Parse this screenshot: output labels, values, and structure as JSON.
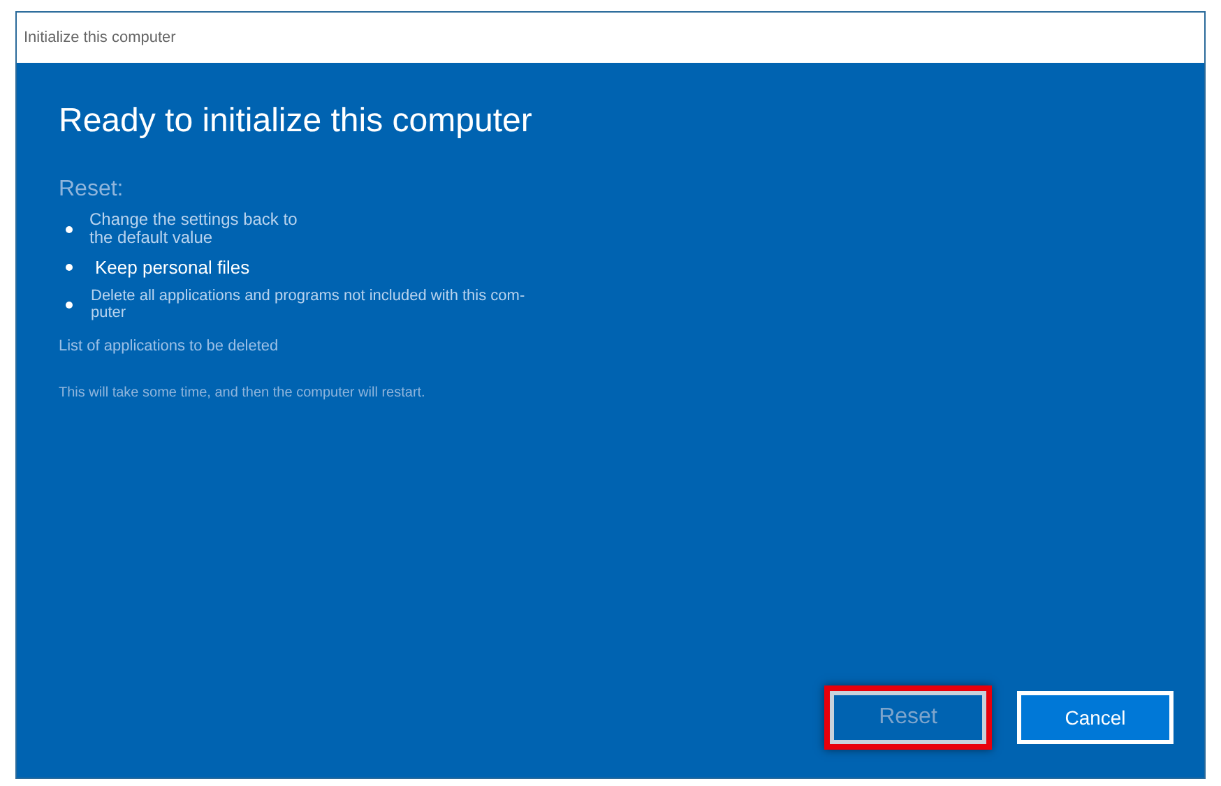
{
  "window": {
    "title": "Initialize this computer"
  },
  "heading": "Ready to initialize this computer",
  "section_label": "Reset:",
  "bullets": [
    {
      "text": "Change the settings back to\nthe default value",
      "kind": "detail"
    },
    {
      "text": "Keep personal files",
      "kind": "main"
    },
    {
      "text": "Delete all applications and programs not included with this com-\nputer",
      "kind": "small"
    }
  ],
  "list_link": "List of applications to be deleted",
  "note": "This will take some time, and then the computer will restart.",
  "buttons": [
    {
      "label": "Reset",
      "disabled": true,
      "highlighted": true
    },
    {
      "label": "Cancel",
      "disabled": false,
      "highlighted": false
    }
  ]
}
